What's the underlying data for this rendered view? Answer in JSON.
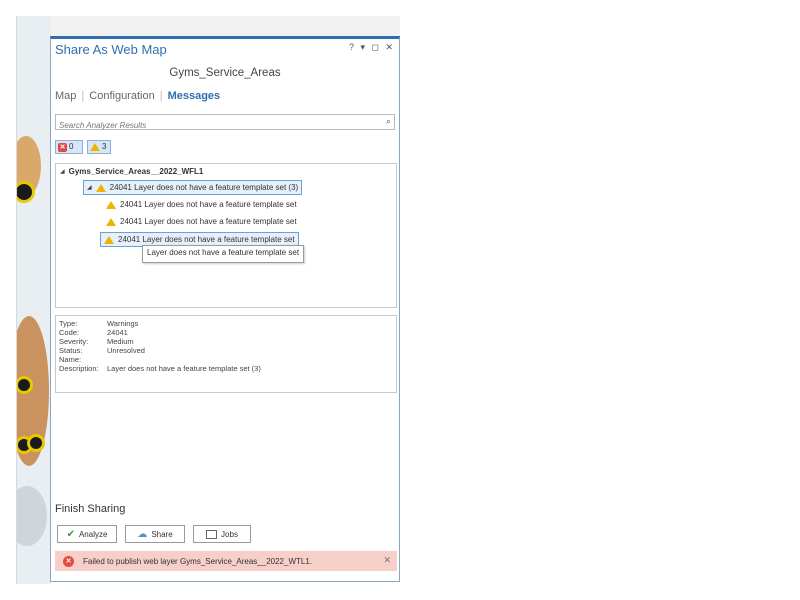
{
  "pane": {
    "title": "Share As Web Map",
    "controls": "? ▾ ◻ ✕",
    "subtitle": "Gyms_Service_Areas"
  },
  "tabs": [
    "Map",
    "Configuration",
    "Messages"
  ],
  "search": {
    "placeholder": "Search Analyzer Results"
  },
  "filters": {
    "errors": "0",
    "warnings": "3"
  },
  "tree": {
    "root": "Gyms_Service_Areas__2022_WFL1",
    "group": "24041 Layer does not have a feature template set (3)",
    "items": [
      "24041 Layer does not have a feature template set",
      "24041 Layer does not have a feature template set",
      "24041 Layer does not have a feature template set"
    ],
    "tooltip": "Layer does not have a feature template set"
  },
  "details": {
    "labels": [
      "Type:",
      "Code:",
      "Severity:",
      "Status:",
      "Name:",
      "Description:"
    ],
    "values": [
      "Warnings",
      "24041",
      "Medium",
      "Unresolved",
      "",
      "Layer does not have a feature template set (3)"
    ]
  },
  "finish": {
    "title": "Finish Sharing",
    "analyze": "Analyze",
    "share": "Share",
    "jobs": "Jobs"
  },
  "banner": {
    "text": "Failed to publish web layer Gyms_Service_Areas__2022_WTL1."
  },
  "colors": {
    "accent": "#2f6fb0",
    "error": "#e04848",
    "warning": "#f0b400",
    "banner_bg": "#f6cfc9"
  }
}
